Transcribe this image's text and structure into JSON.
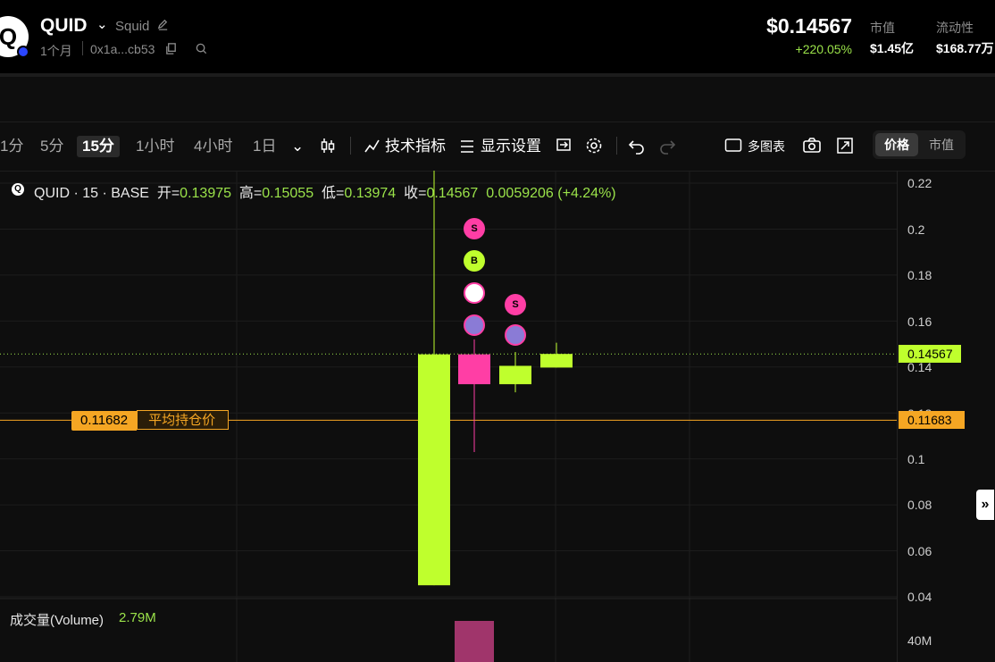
{
  "header": {
    "logo_letter": "Q",
    "token_name": "QUID",
    "token_sub": "Squid",
    "age": "1个月",
    "address": "0x1a...cb53",
    "price": "$0.14567",
    "change": "+220.05%",
    "stats": [
      {
        "label": "市值",
        "value": "$1.45亿"
      },
      {
        "label": "流动性",
        "value": "$168.77万"
      }
    ]
  },
  "toolbar": {
    "timeframes": [
      "1分",
      "5分",
      "15分",
      "1小时",
      "4小时",
      "1日"
    ],
    "active_timeframe": "15分",
    "indicators_label": "技术指标",
    "display_label": "显示设置",
    "multi_chart_label": "多图表",
    "segments": [
      "价格",
      "市值"
    ],
    "active_segment": "价格"
  },
  "legend": {
    "symbol": "QUID · 15 · BASE",
    "open_label": "开=",
    "open": "0.13975",
    "high_label": "高=",
    "high": "0.15055",
    "low_label": "低=",
    "low": "0.13974",
    "close_label": "收=",
    "close": "0.14567",
    "change": "0.0059206 (+4.24%)"
  },
  "price_axis": {
    "ticks": [
      "0.22",
      "0.2",
      "0.18",
      "0.16",
      "0.14",
      "0.12",
      "0.1",
      "0.08",
      "0.06",
      "0.04"
    ],
    "current_price": "0.14567",
    "avg_price": "0.11683",
    "volume_tick": "40M"
  },
  "avg_line": {
    "value": "0.11682",
    "label": "平均持仓价"
  },
  "volume": {
    "label": "成交量(Volume)",
    "value": "2.79M"
  },
  "chart_data": {
    "type": "candlestick",
    "candles": [
      {
        "open": 0.045,
        "high": 0.2272,
        "low": 0.045,
        "close": 0.1455,
        "dir": "up"
      },
      {
        "open": 0.1455,
        "high": 0.152,
        "low": 0.103,
        "close": 0.1325,
        "dir": "down"
      },
      {
        "open": 0.1325,
        "high": 0.1465,
        "low": 0.129,
        "close": 0.1405,
        "dir": "up"
      },
      {
        "open": 0.13975,
        "high": 0.15055,
        "low": 0.13974,
        "close": 0.14567,
        "dir": "up"
      }
    ],
    "markers": [
      {
        "candle": 1,
        "letter": "S",
        "type": "sell",
        "price": 0.2
      },
      {
        "candle": 1,
        "letter": "B",
        "type": "buy",
        "price": 0.186
      },
      {
        "candle": 1,
        "letter": "",
        "type": "avatar-a",
        "price": 0.172
      },
      {
        "candle": 1,
        "letter": "",
        "type": "avatar-b",
        "price": 0.158
      },
      {
        "candle": 2,
        "letter": "S",
        "type": "sell",
        "price": 0.167
      },
      {
        "candle": 2,
        "letter": "",
        "type": "avatar-b",
        "price": 0.154
      }
    ],
    "ylim": [
      0.04,
      0.22
    ],
    "avg_price": 0.11682,
    "current_price": 0.14567,
    "volume_values": [
      null,
      2.79,
      null,
      null
    ],
    "volume_axis_max": 40,
    "colors": {
      "up": "#bfff2d",
      "down": "#ff3ea5",
      "avg": "#f5a623",
      "volume_down": "#a0356b"
    }
  }
}
